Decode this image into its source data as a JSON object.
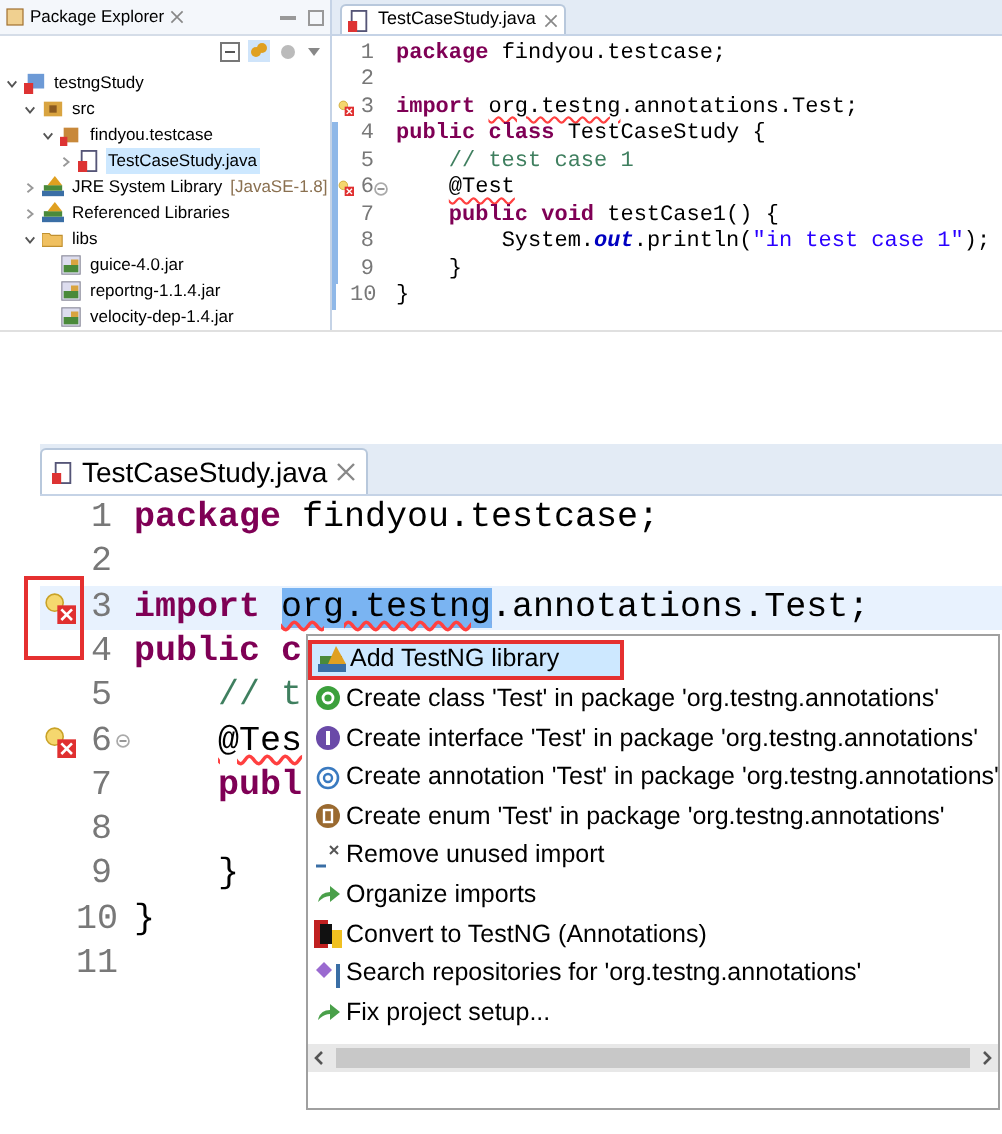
{
  "explorer": {
    "title": "Package Explorer",
    "tree": [
      {
        "label": "testngStudy",
        "kind": "project",
        "expanded": true,
        "selected": false,
        "children": [
          {
            "label": "src",
            "kind": "source-folder",
            "expanded": true,
            "selected": false,
            "children": [
              {
                "label": "findyou.testcase",
                "kind": "package",
                "expanded": true,
                "selected": false,
                "children": [
                  {
                    "label": "TestCaseStudy.java",
                    "kind": "java-file",
                    "expanded": false,
                    "selected": true
                  }
                ]
              }
            ]
          },
          {
            "label": "JRE System Library",
            "decoration": "[JavaSE-1.8]",
            "kind": "library",
            "expanded": false,
            "selected": false
          },
          {
            "label": "Referenced Libraries",
            "kind": "library",
            "expanded": false,
            "selected": false
          },
          {
            "label": "libs",
            "kind": "folder",
            "expanded": true,
            "selected": false,
            "children": [
              {
                "label": "guice-4.0.jar",
                "kind": "jar",
                "selected": false
              },
              {
                "label": "reportng-1.1.4.jar",
                "kind": "jar",
                "selected": false
              },
              {
                "label": "velocity-dep-1.4.jar",
                "kind": "jar",
                "selected": false
              }
            ]
          }
        ]
      }
    ]
  },
  "top_editor": {
    "tab": "TestCaseStudy.java",
    "lines": [
      {
        "number": "1",
        "error": false,
        "changed": false,
        "tokens": [
          {
            "text": "package ",
            "kind": "keyword"
          },
          {
            "text": "findyou.testcase;",
            "kind": "plain"
          }
        ]
      },
      {
        "number": "2",
        "error": false,
        "changed": false
      },
      {
        "number": "3",
        "error": true,
        "changed": false,
        "tokens": [
          {
            "text": "import ",
            "kind": "keyword"
          },
          {
            "text": "org.testng",
            "kind": "plain",
            "error": true
          },
          {
            "text": ".annotations.Test;",
            "kind": "plain"
          }
        ]
      },
      {
        "number": "4",
        "error": false,
        "changed": true,
        "tokens": [
          {
            "text": "public class ",
            "kind": "keyword"
          },
          {
            "text": "TestCaseStudy {",
            "kind": "plain"
          }
        ]
      },
      {
        "number": "5",
        "error": false,
        "changed": true,
        "tokens": [
          {
            "text": "    // test case 1",
            "kind": "comment"
          }
        ]
      },
      {
        "number": "6",
        "error": true,
        "changed": true,
        "fold": true,
        "tokens": [
          {
            "text": "    @Test",
            "kind": "plain",
            "error": true
          }
        ]
      },
      {
        "number": "7",
        "error": false,
        "changed": true,
        "tokens": [
          {
            "text": "    public void ",
            "kind": "keyword"
          },
          {
            "text": "testCase1() {",
            "kind": "plain"
          }
        ]
      },
      {
        "number": "8",
        "error": false,
        "changed": true,
        "tokens": [
          {
            "text": "        System.",
            "kind": "plain"
          },
          {
            "text": "out",
            "kind": "field"
          },
          {
            "text": ".println(",
            "kind": "plain"
          },
          {
            "text": "\"in test case 1\"",
            "kind": "string"
          },
          {
            "text": ");",
            "kind": "plain"
          }
        ]
      },
      {
        "number": "9",
        "error": false,
        "changed": true,
        "tokens": [
          {
            "text": "    }",
            "kind": "plain"
          }
        ]
      },
      {
        "number": "10",
        "error": false,
        "changed": true,
        "tokens": [
          {
            "text": "}",
            "kind": "plain"
          }
        ]
      }
    ]
  },
  "bottom_editor": {
    "tab": "TestCaseStudy.java",
    "lines": [
      {
        "number": "1",
        "error": false,
        "current": false,
        "tokens": [
          {
            "text": "package ",
            "kind": "keyword"
          },
          {
            "text": "findyou.testcase;",
            "kind": "plain"
          }
        ]
      },
      {
        "number": "2",
        "error": false,
        "current": false
      },
      {
        "number": "3",
        "error": true,
        "current": true,
        "tokens": [
          {
            "text": "import ",
            "kind": "keyword"
          },
          {
            "text": "org.testng",
            "kind": "plain",
            "error": true,
            "selected": true
          },
          {
            "text": ".annotations.Test;",
            "kind": "plain"
          }
        ]
      },
      {
        "number": "4",
        "error": false,
        "current": false,
        "tokens": [
          {
            "text": "public c",
            "kind": "keyword"
          }
        ]
      },
      {
        "number": "5",
        "error": false,
        "current": false,
        "tokens": [
          {
            "text": "    // t",
            "kind": "comment"
          }
        ]
      },
      {
        "number": "6",
        "error": true,
        "current": false,
        "fold": true,
        "tokens": [
          {
            "text": "    @Tes",
            "kind": "plain",
            "error": true
          }
        ]
      },
      {
        "number": "7",
        "error": false,
        "current": false,
        "tokens": [
          {
            "text": "    publ",
            "kind": "keyword"
          }
        ]
      },
      {
        "number": "8",
        "error": false,
        "current": false
      },
      {
        "number": "9",
        "error": false,
        "current": false,
        "tokens": [
          {
            "text": "    }",
            "kind": "plain"
          }
        ]
      },
      {
        "number": "10",
        "error": false,
        "current": false,
        "tokens": [
          {
            "text": "}",
            "kind": "plain"
          }
        ]
      },
      {
        "number": "11",
        "error": false,
        "current": false
      }
    ]
  },
  "quick_fix": {
    "items": [
      {
        "label": "Add TestNG library",
        "kind": "library",
        "selected": true
      },
      {
        "label": "Create class 'Test' in package 'org.testng.annotations'",
        "kind": "class",
        "selected": false
      },
      {
        "label": "Create interface 'Test' in package 'org.testng.annotations'",
        "kind": "interface",
        "selected": false
      },
      {
        "label": "Create annotation 'Test' in package 'org.testng.annotations'",
        "kind": "annotation",
        "selected": false
      },
      {
        "label": "Create enum 'Test' in package 'org.testng.annotations'",
        "kind": "enum",
        "selected": false
      },
      {
        "label": "Remove unused import",
        "kind": "remove",
        "selected": false
      },
      {
        "label": "Organize imports",
        "kind": "arrow",
        "selected": false
      },
      {
        "label": "Convert to TestNG (Annotations)",
        "kind": "testng",
        "selected": false
      },
      {
        "label": "Search repositories for 'org.testng.annotations'",
        "kind": "search-repo",
        "selected": false
      },
      {
        "label": "Fix project setup...",
        "kind": "arrow",
        "selected": false
      }
    ]
  }
}
